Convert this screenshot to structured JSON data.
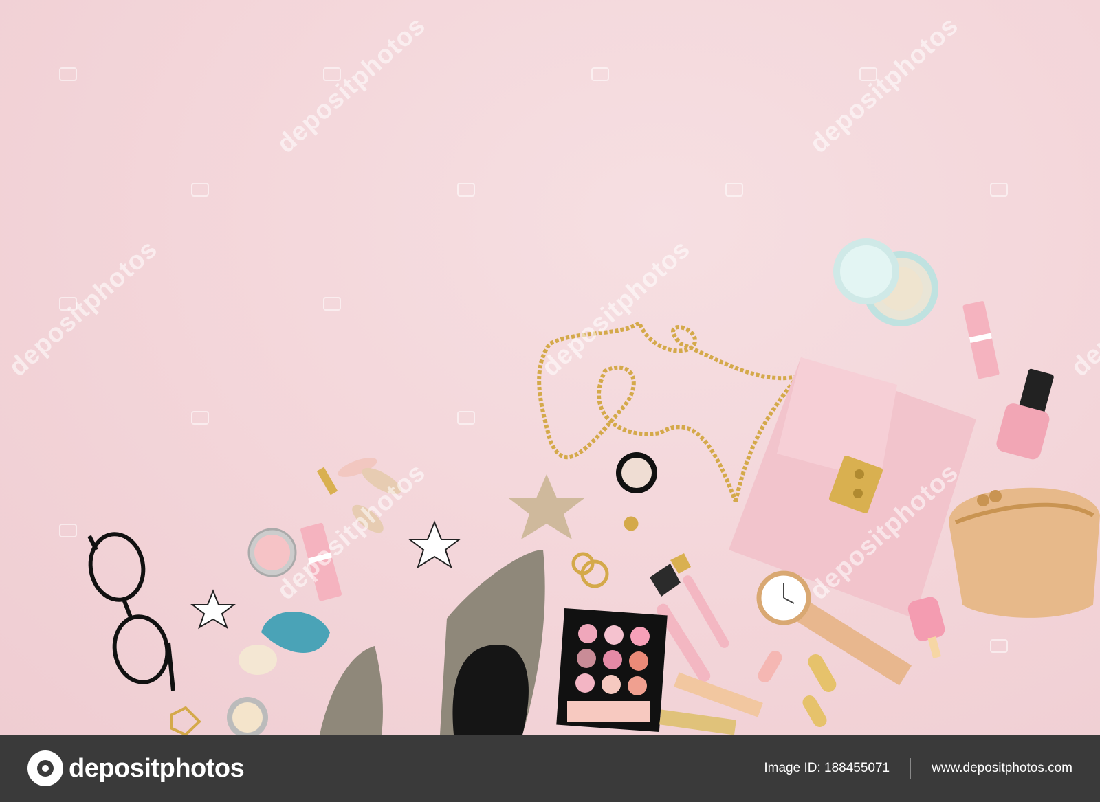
{
  "photo": {
    "watermark_text": "depositphotos",
    "background_color": "#f4d9dc",
    "objects": [
      "glasses-icon",
      "star-earring-icon",
      "shell-brush-icon",
      "snakeskin-shoe-icon",
      "eyeshadow-palette-icon",
      "makeup-brush-icon",
      "gold-chain-icon",
      "pink-clutch-icon",
      "coin-purse-icon",
      "watch-icon",
      "nail-polish-icon",
      "lipstick-icon",
      "powder-compact-icon",
      "blush-compact-icon",
      "star-brooch-icon",
      "keychain-icon",
      "popsicle-icon"
    ]
  },
  "footer": {
    "logo_text": "depositphotos",
    "image_id": "Image ID: 188455071",
    "site": "www.depositphotos.com",
    "background": "#3a3a3a"
  }
}
